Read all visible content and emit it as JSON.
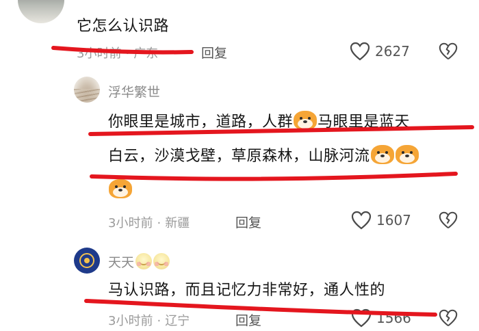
{
  "comments": [
    {
      "text": "它怎么认识路",
      "time": "3小时前",
      "location": "广东",
      "reply_label": "回复",
      "likes": "2627"
    },
    {
      "username": "浮华繁世",
      "line1": "你眼里是城市，道路，人群",
      "line1b": "马眼里是蓝天",
      "line2": "白云，沙漠戈壁，草原森林，山脉河流",
      "time": "3小时前",
      "location": "新疆",
      "reply_label": "回复",
      "likes": "1607"
    },
    {
      "username": "天天",
      "text": "马认识路，而且记忆力非常好，通人性的",
      "time": "3小时前",
      "location": "辽宁",
      "reply_label": "回复",
      "likes": "1566"
    }
  ],
  "separator": "·",
  "icons": {
    "like": "heart-outline-icon",
    "dislike": "broken-heart-icon",
    "tiger": "tiger-emoji",
    "smile": "smile-emoji"
  },
  "colors": {
    "annotation": "#e4161e",
    "meta": "#9a9a9a",
    "text": "#161616"
  }
}
